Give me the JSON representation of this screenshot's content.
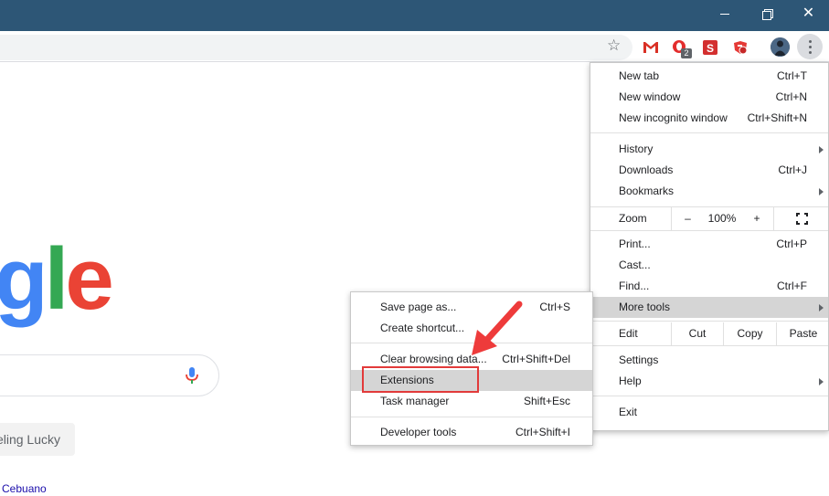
{
  "window_controls": {
    "minimize_label": "",
    "maximize_label": "",
    "close_label": "✕"
  },
  "toolbar": {
    "star_glyph": "☆",
    "opera_badge": "2",
    "s_extension_letter": "S"
  },
  "page": {
    "logo": {
      "g": "g",
      "l": "l",
      "e": "e"
    },
    "lucky_button": "eling Lucky",
    "language_link": "Cebuano"
  },
  "menu": {
    "new_tab": {
      "label": "New tab",
      "shortcut": "Ctrl+T"
    },
    "new_window": {
      "label": "New window",
      "shortcut": "Ctrl+N"
    },
    "new_incognito": {
      "label": "New incognito window",
      "shortcut": "Ctrl+Shift+N"
    },
    "history": {
      "label": "History"
    },
    "downloads": {
      "label": "Downloads",
      "shortcut": "Ctrl+J"
    },
    "bookmarks": {
      "label": "Bookmarks"
    },
    "zoom": {
      "label": "Zoom",
      "minus": "–",
      "level": "100%",
      "plus": "+"
    },
    "print": {
      "label": "Print...",
      "shortcut": "Ctrl+P"
    },
    "cast": {
      "label": "Cast..."
    },
    "find": {
      "label": "Find...",
      "shortcut": "Ctrl+F"
    },
    "more_tools": {
      "label": "More tools"
    },
    "edit": {
      "label": "Edit",
      "cut": "Cut",
      "copy": "Copy",
      "paste": "Paste"
    },
    "settings": {
      "label": "Settings"
    },
    "help": {
      "label": "Help"
    },
    "exit": {
      "label": "Exit"
    }
  },
  "submenu": {
    "save_page": {
      "label": "Save page as...",
      "shortcut": "Ctrl+S"
    },
    "create_shortcut": {
      "label": "Create shortcut..."
    },
    "clear_browsing": {
      "label": "Clear browsing data...",
      "shortcut": "Ctrl+Shift+Del"
    },
    "extensions": {
      "label": "Extensions"
    },
    "task_manager": {
      "label": "Task manager",
      "shortcut": "Shift+Esc"
    },
    "developer_tools": {
      "label": "Developer tools",
      "shortcut": "Ctrl+Shift+I"
    }
  },
  "colors": {
    "titlebar": "#2d5676",
    "highlight_box": "#e23a3a",
    "menu_hover": "#d5d5d5"
  }
}
